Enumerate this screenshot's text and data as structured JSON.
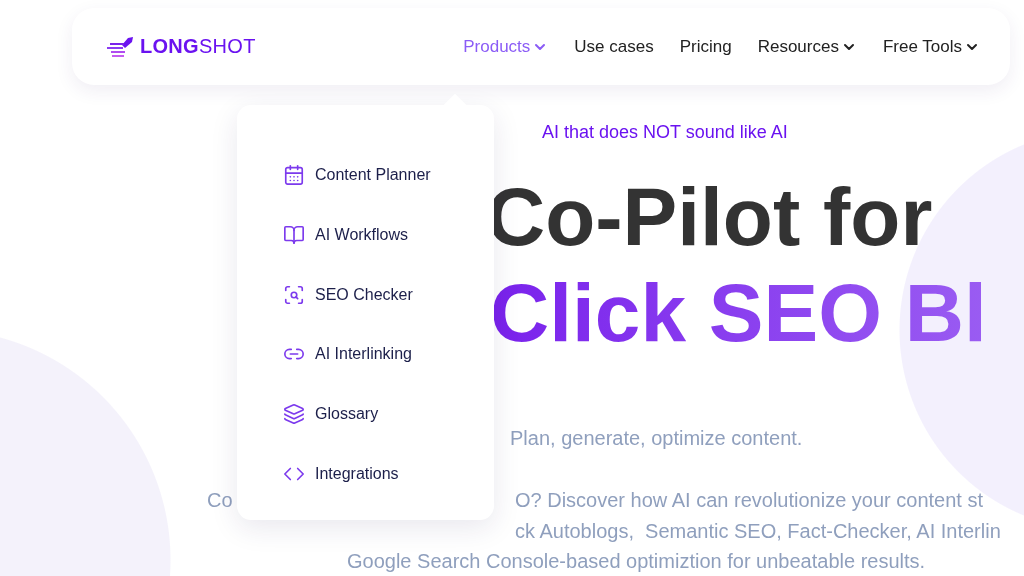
{
  "logo": "**LONG**SHOT",
  "nav": [
    {
      "label": "Products",
      "selected": true,
      "dropdown": true
    },
    {
      "label": "Use cases",
      "selected": false,
      "dropdown": false
    },
    {
      "label": "Pricing",
      "selected": false,
      "dropdown": false
    },
    {
      "label": "Resources",
      "selected": false,
      "dropdown": true
    },
    {
      "label": "Free Tools",
      "selected": false,
      "dropdown": true
    }
  ],
  "products_menu": [
    {
      "label": "Content Planner",
      "kind": "calendar"
    },
    {
      "label": "AI Workflows",
      "kind": "book"
    },
    {
      "label": "SEO Checker",
      "kind": "search"
    },
    {
      "label": "AI Interlinking",
      "kind": "link"
    },
    {
      "label": "Glossary",
      "kind": "cards"
    },
    {
      "label": "Integrations",
      "kind": "code"
    }
  ],
  "hero": {
    "tagline": "AI that does NOT sound like AI",
    "heading_line_1": "Co-Pilot for",
    "heading_line_2": "Click SEO Bl",
    "subtitle": "Plan, generate, optimize content.",
    "paragraph_line_1_left": "Co",
    "paragraph_line_1_right": "O? Discover how AI can revolutionize your content st",
    "paragraph_line_2": "ck Autoblogs,  Semantic SEO, Fact-Checker, AI Interlin",
    "paragraph_line_3": "Google Search Console-based optimiztion for unbeatable results."
  }
}
